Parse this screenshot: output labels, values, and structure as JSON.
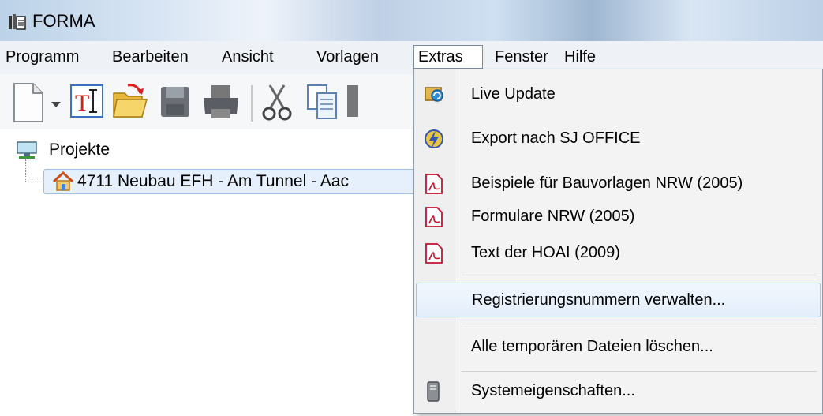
{
  "window": {
    "title": "FORMA"
  },
  "menubar": {
    "items": [
      {
        "label": "Programm"
      },
      {
        "label": "Bearbeiten"
      },
      {
        "label": "Ansicht"
      },
      {
        "label": "Vorlagen"
      },
      {
        "label": "Extras",
        "active": true
      },
      {
        "label": "Fenster"
      },
      {
        "label": "Hilfe"
      }
    ]
  },
  "toolbar": {
    "buttons": [
      "new-document-icon",
      "dropdown-arrow-icon",
      "text-tool-icon",
      "open-folder-icon",
      "save-icon",
      "print-icon",
      "cut-icon",
      "copy-icon"
    ]
  },
  "tree": {
    "root": {
      "label": "Projekte",
      "icon": "network-computer-icon"
    },
    "children": [
      {
        "label": "4711 Neubau EFH - Am Tunnel - Aac",
        "icon": "house-icon",
        "selected": true
      }
    ]
  },
  "extras_menu": {
    "items": [
      {
        "label": "Live Update",
        "icon": "live-update-icon"
      },
      {
        "label": "Export nach SJ OFFICE",
        "icon": "lightning-export-icon"
      },
      {
        "label": "Beispiele für Bauvorlagen NRW (2005)",
        "icon": "pdf-icon"
      },
      {
        "label": "Formulare NRW (2005)",
        "icon": "pdf-icon"
      },
      {
        "label": "Text der HOAI (2009)",
        "icon": "pdf-icon"
      },
      {
        "label": "Registrierungsnummern verwalten...",
        "highlighted": true
      },
      {
        "label": "Alle temporären Dateien löschen..."
      },
      {
        "label": "Systemeigenschaften...",
        "icon": "system-properties-icon"
      }
    ]
  },
  "colors": {
    "menu_hover_border": "#a8c5ea",
    "tree_selection": "#e6f0fc",
    "pdf_red": "#c8102e"
  }
}
